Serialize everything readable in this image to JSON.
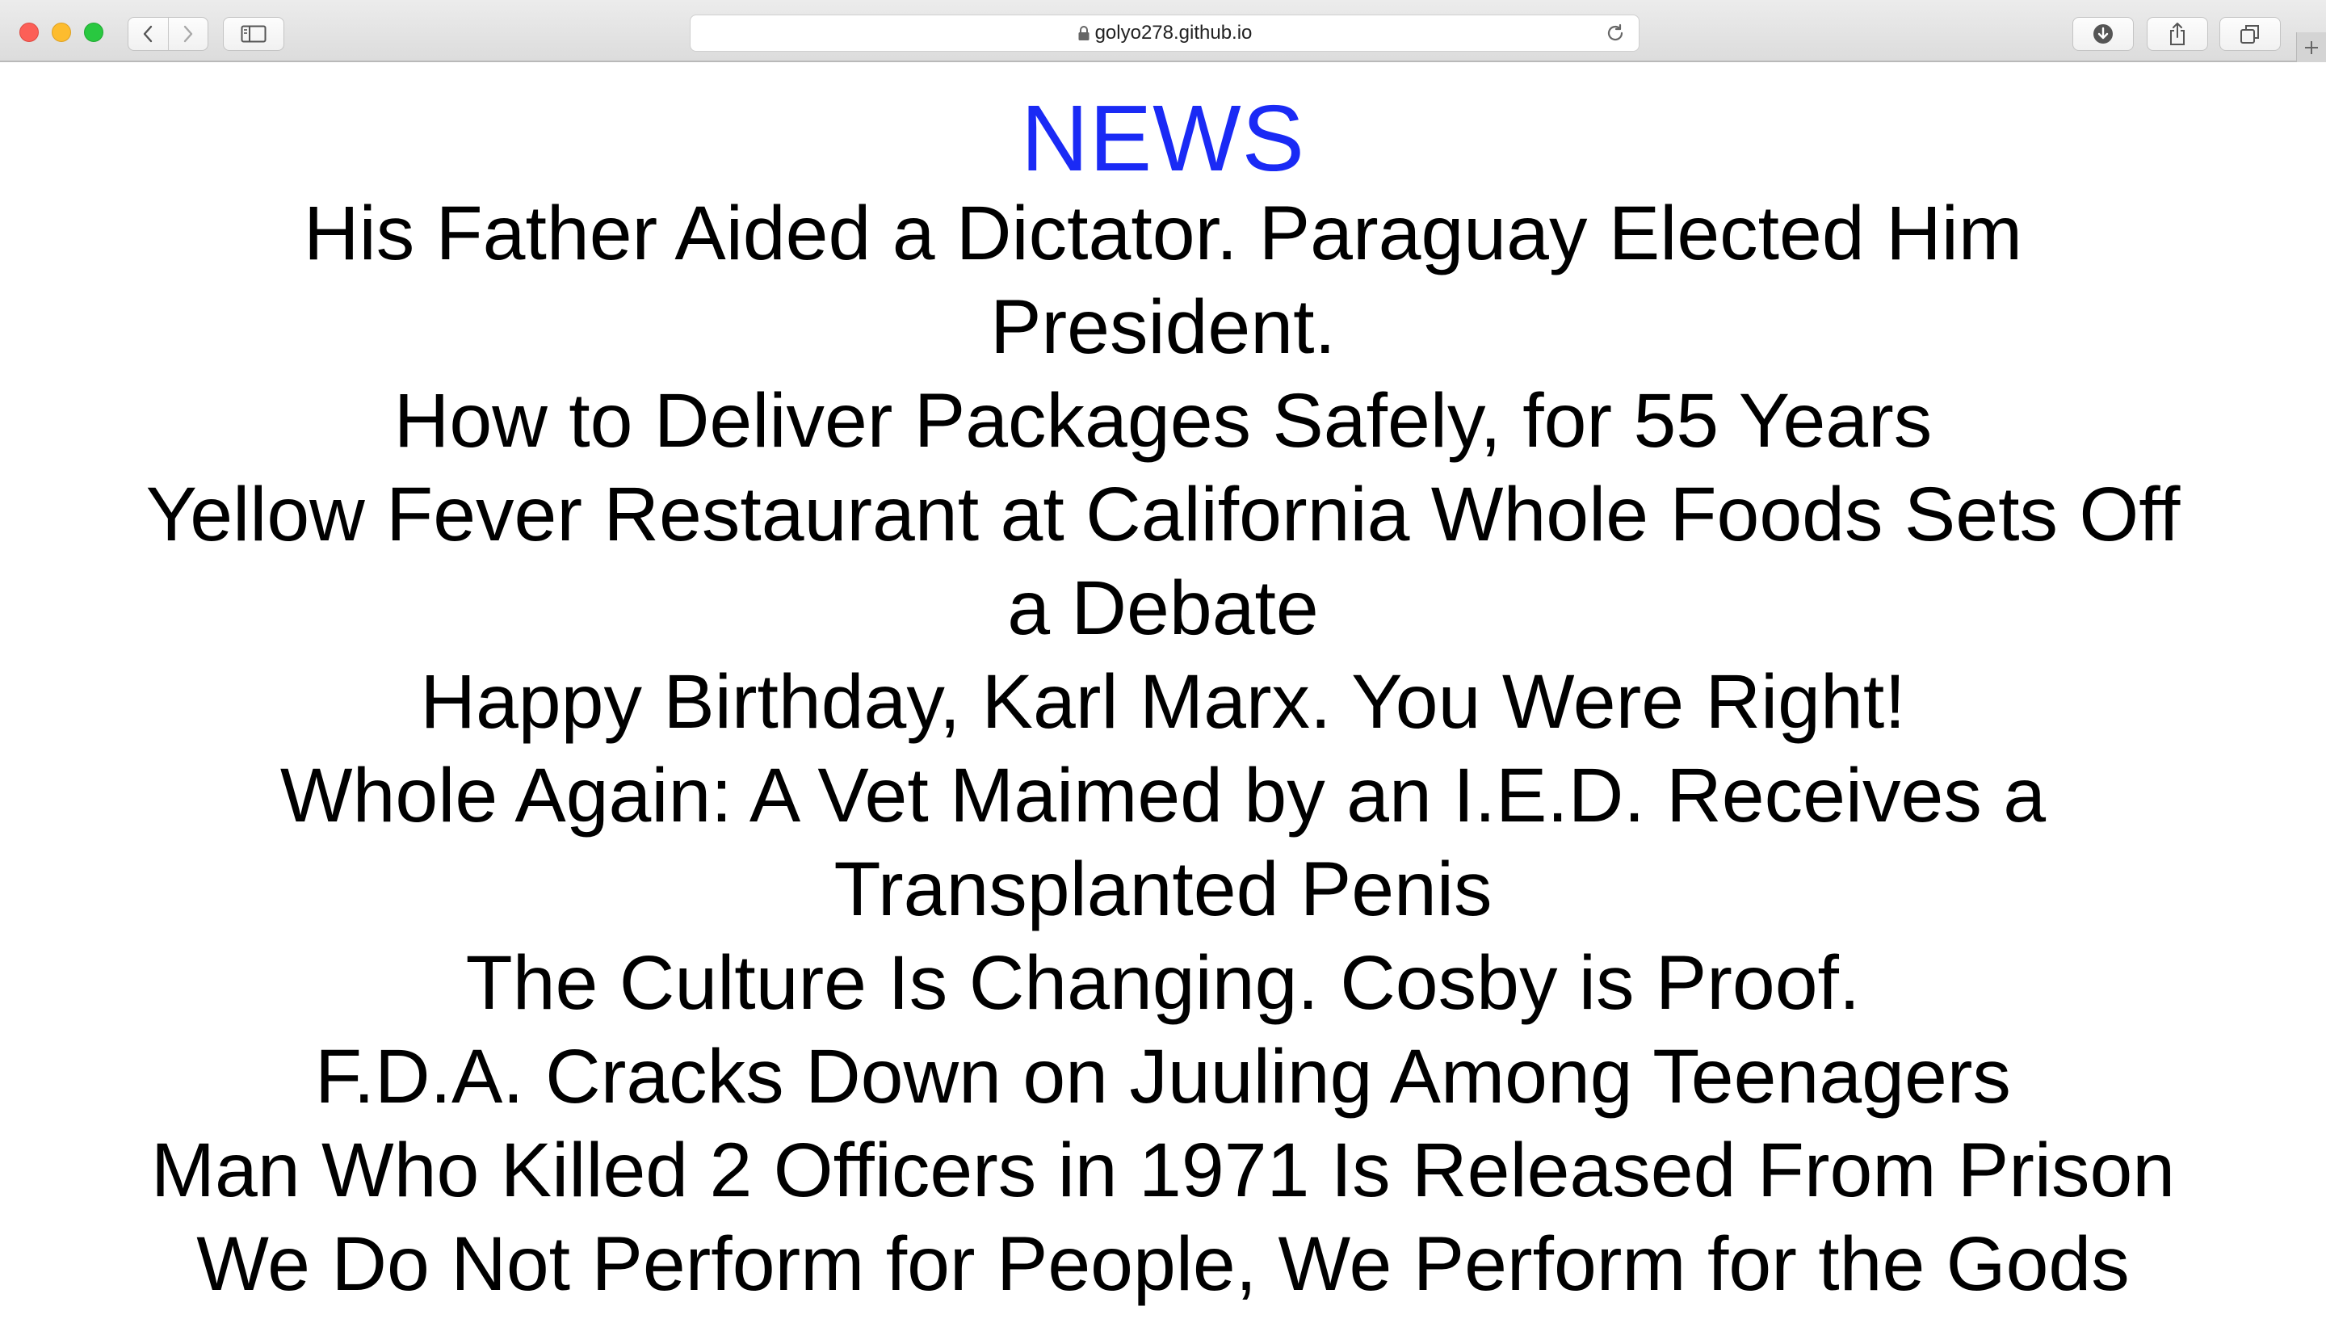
{
  "browser": {
    "url": "golyo278.github.io"
  },
  "page": {
    "title": "NEWS",
    "headlines": [
      "His Father Aided a Dictator. Paraguay Elected Him President.",
      "How to Deliver Packages Safely, for 55 Years",
      "Yellow Fever Restaurant at California Whole Foods Sets Off a Debate",
      "Happy Birthday, Karl Marx. You Were Right!",
      "Whole Again: A Vet Maimed by an I.E.D. Receives a Transplanted Penis",
      "The Culture Is Changing. Cosby is Proof.",
      "F.D.A. Cracks Down on Juuling Among Teenagers",
      "Man Who Killed 2 Officers in 1971 Is Released From Prison",
      "We Do Not Perform for People, We Perform for the Gods"
    ]
  },
  "colors": {
    "title": "#1a2af5",
    "text": "#000000",
    "close": "#fc5f57",
    "minimize": "#fdbc2e",
    "maximize": "#29c840"
  }
}
